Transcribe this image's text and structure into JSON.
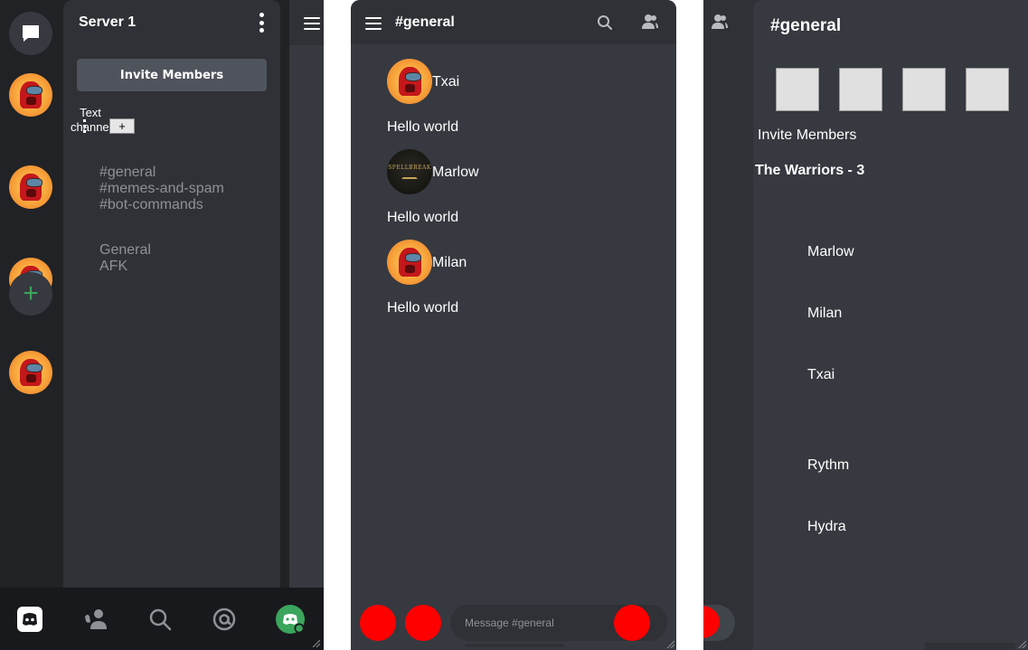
{
  "server": {
    "name": "Server 1",
    "invite_label": "Invite Members",
    "text_channels_label": "Text channels",
    "add_channel_label": "+",
    "text_channels": [
      "#general",
      "#memes-and-spam",
      "#bot-commands"
    ],
    "voice_channels": [
      "General",
      "AFK"
    ],
    "add_server_label": "+"
  },
  "nav": {
    "icons": [
      "discord-home-icon",
      "friends-icon",
      "search-icon",
      "mentions-icon",
      "profile-avatar-icon"
    ]
  },
  "chat": {
    "channel_title": "#general",
    "messages": [
      {
        "author": "Txai",
        "content": "Hello world",
        "avatar": "among-us-avatar"
      },
      {
        "author": "Marlow",
        "content": "Hello world",
        "avatar": "spellbreak-avatar",
        "avatar_text": "SPELLBREAK"
      },
      {
        "author": "Milan",
        "content": "Hello world",
        "avatar": "among-us-avatar"
      }
    ],
    "input_placeholder": "Message #general"
  },
  "members_panel": {
    "title": "#general",
    "invite_label": "Invite Members",
    "role_header": "The Warriors - 3",
    "members": [
      "Marlow",
      "Milan",
      "Txai",
      "Rythm",
      "Hydra"
    ]
  },
  "colors": {
    "rail": "#202225",
    "sidebar": "#2f3136",
    "chat_bg": "#36393f",
    "muted_text": "#8e9297",
    "accent_green": "#3ba55d",
    "placeholder_red": "#ff0000"
  }
}
